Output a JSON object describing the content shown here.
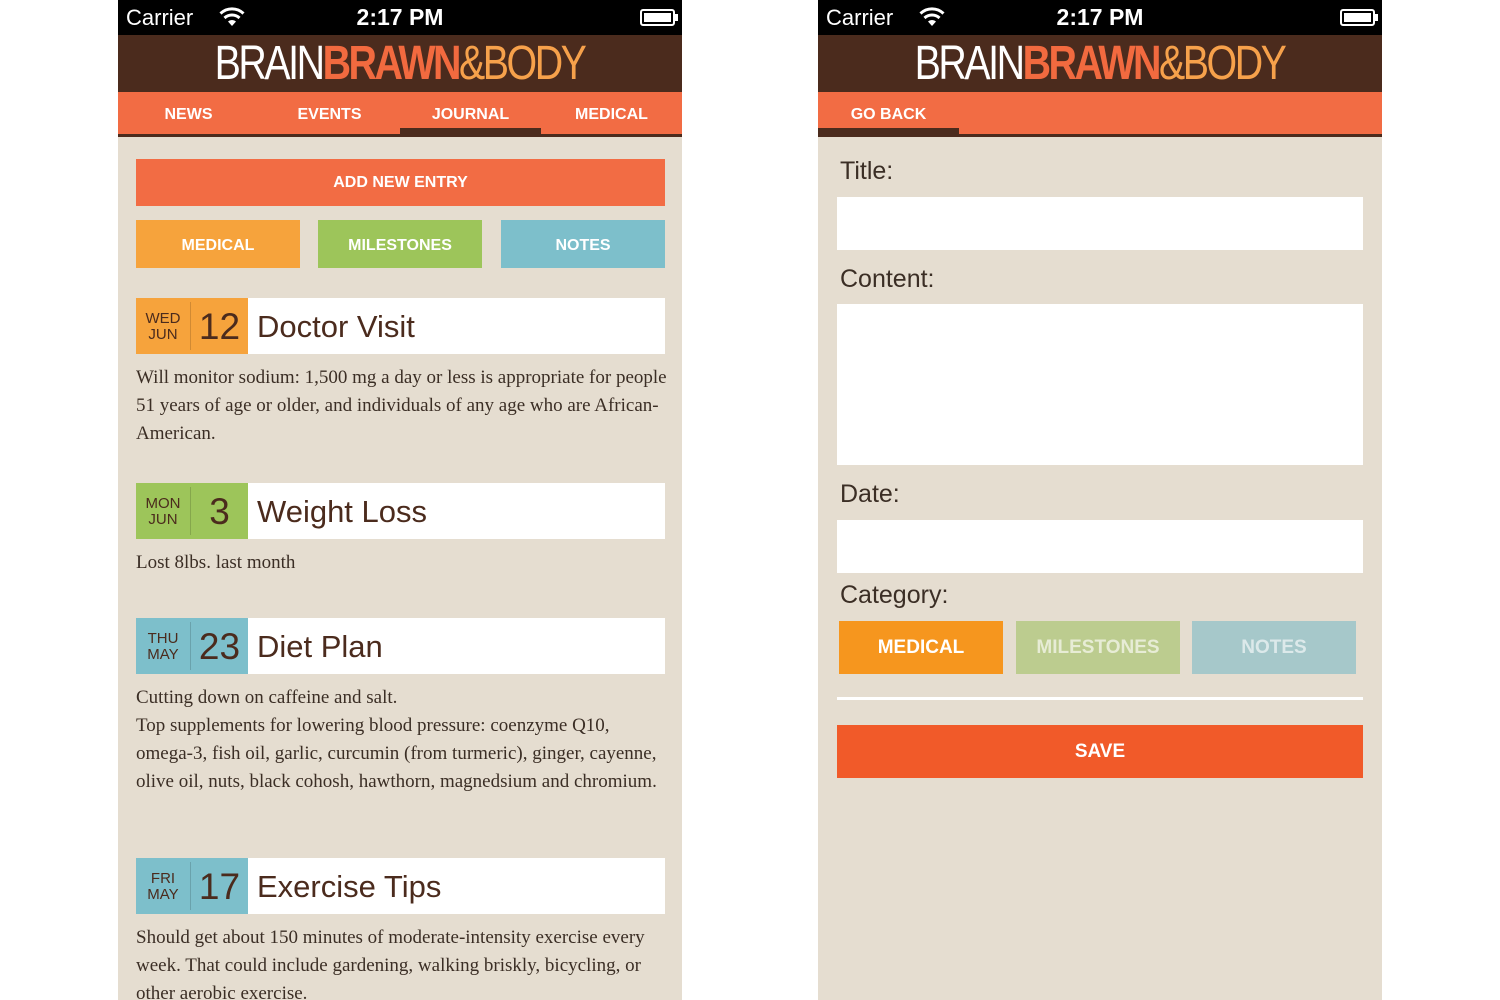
{
  "status_bar": {
    "carrier": "Carrier",
    "time": "2:17 PM"
  },
  "brand": {
    "part1": "BRAIN",
    "part2": "BRAWN",
    "part3": "&BODY"
  },
  "colors": {
    "brand_dark": "#4b2b1d",
    "accent_orange": "#f26c44",
    "medical": "#f6a33c",
    "milestones": "#9dc55a",
    "notes": "#7dbfcb",
    "background": "#e5ddd0",
    "save": "#f15a29"
  },
  "journal_screen": {
    "nav_tabs": [
      {
        "label": "NEWS",
        "active": false
      },
      {
        "label": "EVENTS",
        "active": false
      },
      {
        "label": "JOURNAL",
        "active": true
      },
      {
        "label": "MEDICAL",
        "active": false
      }
    ],
    "add_entry_label": "ADD NEW ENTRY",
    "filters": [
      "MEDICAL",
      "MILESTONES",
      "NOTES"
    ],
    "entries": [
      {
        "dow": "WED",
        "month": "JUN",
        "day": "12",
        "title": "Doctor Visit",
        "category": "medical",
        "body": "Will monitor sodium: 1,500 mg a day or less is appropriate for people 51 years of age or older, and individuals of any age who are African-American."
      },
      {
        "dow": "MON",
        "month": "JUN",
        "day": "3",
        "title": "Weight Loss",
        "category": "milestones",
        "body": "Lost 8lbs. last month"
      },
      {
        "dow": "THU",
        "month": "MAY",
        "day": "23",
        "title": "Diet Plan",
        "category": "notes",
        "body": "Cutting down on caffeine and salt.\nTop supplements for lowering blood pressure: coenzyme Q10, omega-3, fish oil, garlic, curcumin (from turmeric), ginger, cayenne, olive oil, nuts, black cohosh, hawthorn, magnedsium and chromium."
      },
      {
        "dow": "FRI",
        "month": "MAY",
        "day": "17",
        "title": "Exercise Tips",
        "category": "notes",
        "body": "Should get about 150 minutes of moderate-intensity exercise every week. That could include gardening, walking briskly, bicycling, or other aerobic exercise."
      }
    ]
  },
  "new_entry_screen": {
    "back_label": "GO BACK",
    "labels": {
      "title": "Title:",
      "content": "Content:",
      "date": "Date:",
      "category": "Category:"
    },
    "values": {
      "title": "",
      "content": "",
      "date": ""
    },
    "categories": [
      {
        "label": "MEDICAL",
        "selected": true
      },
      {
        "label": "MILESTONES",
        "selected": false
      },
      {
        "label": "NOTES",
        "selected": false
      }
    ],
    "save_label": "SAVE"
  }
}
